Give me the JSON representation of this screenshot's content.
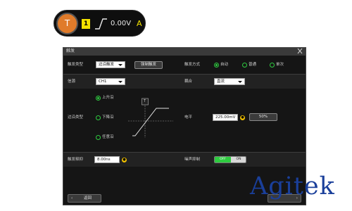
{
  "status_pill": {
    "trigger_icon_label": "T",
    "channel_badge": "1",
    "edge_icon": "rising-edge-icon",
    "level": "0.00V",
    "mode_letter": "A"
  },
  "dialog": {
    "title": "触发",
    "close_icon": "close-icon",
    "row1": {
      "type_label": "触发类型",
      "type_value": "边沿触发",
      "force_button": "强制触发",
      "sweep_label": "触发方式",
      "sweep_options": [
        "自动",
        "普通",
        "单次"
      ],
      "sweep_selected": 0
    },
    "row2": {
      "source_label": "信源",
      "source_value": "CH1",
      "coupling_label": "耦合",
      "coupling_value": "直流"
    },
    "edge": {
      "label": "边沿类型",
      "options": [
        "上升沿",
        "下降沿",
        "任意沿"
      ],
      "selected": 0,
      "marker_label": "T"
    },
    "level": {
      "label": "电平",
      "value": "225.00mV",
      "percent_button": "50%"
    },
    "holdoff": {
      "label": "触发释抑",
      "value": "8.00ns"
    },
    "noise": {
      "label": "噪声抑制",
      "off": "OFF",
      "on": "ON",
      "state": "off"
    },
    "footer": {
      "back_label": "返回"
    }
  },
  "watermark": {
    "text": "Agitek"
  },
  "colors": {
    "accent_green": "#2ecc40",
    "channel_yellow": "#f2e100",
    "trigger_orange": "#e07b2a",
    "watermark_blue": "#1a3f9a",
    "watermark_red": "#d11f1f"
  }
}
